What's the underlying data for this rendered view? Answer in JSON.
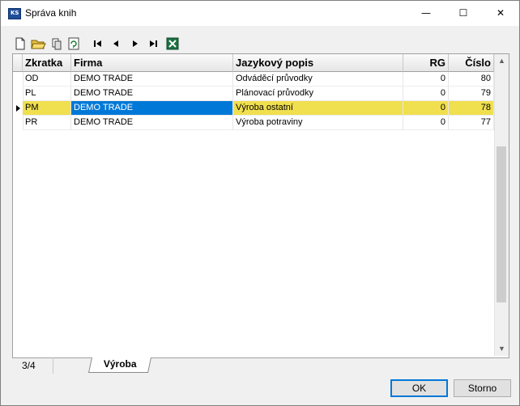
{
  "window": {
    "title": "Správa knih",
    "minimize": "—",
    "maximize": "☐",
    "close": "✕"
  },
  "toolbar": {
    "tools": [
      "new-icon",
      "open-icon",
      "copy-icon",
      "refresh-icon",
      "first-icon",
      "prev-icon",
      "next-icon",
      "last-icon",
      "excel-icon"
    ]
  },
  "grid": {
    "columns": [
      "Zkratka",
      "Firma",
      "Jazykový popis",
      "RG",
      "Číslo"
    ],
    "rows": [
      {
        "code": "OD",
        "firm": "DEMO TRADE",
        "desc": "Odváděcí průvodky",
        "rg": "0",
        "num": "80"
      },
      {
        "code": "PL",
        "firm": "DEMO TRADE",
        "desc": "Plánovací průvodky",
        "rg": "0",
        "num": "79"
      },
      {
        "code": "PM",
        "firm": "DEMO TRADE",
        "desc": "Výroba ostatní",
        "rg": "0",
        "num": "78"
      },
      {
        "code": "PR",
        "firm": "DEMO TRADE",
        "desc": "Výroba  potraviny",
        "rg": "0",
        "num": "77"
      }
    ],
    "selected_row": 2
  },
  "status": {
    "count": "3/4",
    "tab": "Výroba"
  },
  "buttons": {
    "ok": "OK",
    "cancel": "Storno"
  },
  "colors": {
    "selected_row": "#f0df4f",
    "focused_cell": "#0078d7"
  }
}
